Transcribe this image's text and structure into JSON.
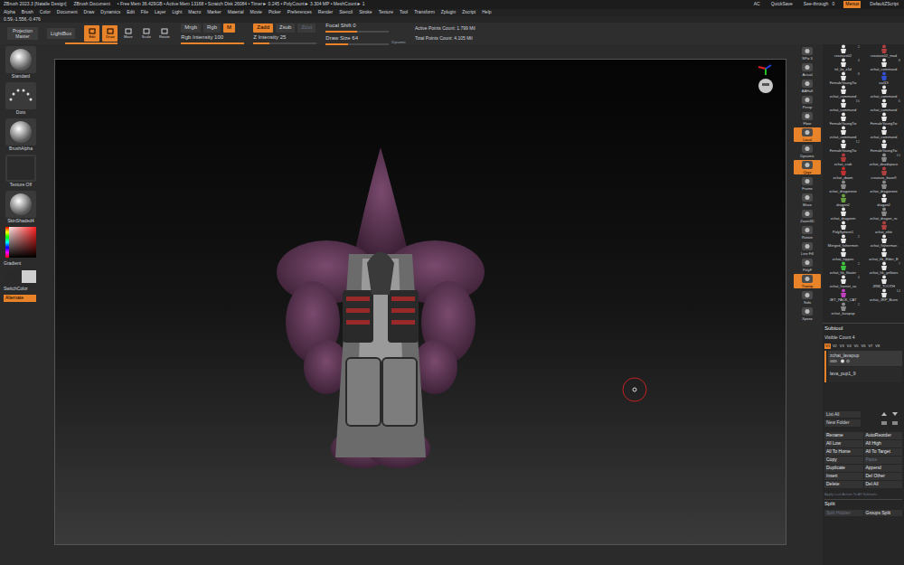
{
  "title_bar": {
    "left": [
      "ZBrush 2023.3 [Natalie Design]",
      "ZBrush Document",
      "• Free Mem 36.429GB • Active Mem 13168 • Scratch Disk 26084 • Timer► 0.245 • PolyCount► 3.304 MP • MeshCount► 1"
    ],
    "right": [
      {
        "label": "AC",
        "selected": false
      },
      {
        "label": "QuickSave",
        "selected": false
      },
      {
        "label": "See-through   0",
        "selected": false
      },
      {
        "label": "Menus",
        "selected": true
      },
      {
        "label": "DefaultZScript",
        "selected": false
      }
    ]
  },
  "menu": [
    "Alpha",
    "Brush",
    "Color",
    "Document",
    "Draw",
    "Dynamics",
    "Edit",
    "File",
    "Layer",
    "Light",
    "Macro",
    "Marker",
    "Material",
    "Movie",
    "Picker",
    "Preferences",
    "Render",
    "Stencil",
    "Stroke",
    "Texture",
    "Tool",
    "Transform",
    "Zplugin",
    "Zscript",
    "Help"
  ],
  "coords": "0.59,-1.556,-0.476",
  "toolbar": {
    "projection": "Projection Master",
    "lightbox": "LightBox",
    "modes": [
      {
        "label": "Edit",
        "selected": true
      },
      {
        "label": "Draw",
        "selected": true
      },
      {
        "label": "Move",
        "selected": false
      },
      {
        "label": "Scale",
        "selected": false
      },
      {
        "label": "Rotate",
        "selected": false
      }
    ],
    "color_modes": [
      {
        "label": "Mrgb",
        "selected": false
      },
      {
        "label": "Rgb",
        "selected": false
      },
      {
        "label": "M",
        "selected": true
      }
    ],
    "rgb_intensity": {
      "label": "Rgb Intensity 100",
      "level": 1
    },
    "z_modes": [
      {
        "label": "Zadd",
        "selected": true,
        "disabled": false
      },
      {
        "label": "Zsub",
        "selected": false,
        "disabled": false
      },
      {
        "label": "Zcut",
        "selected": false,
        "disabled": true
      }
    ],
    "z_intensity": {
      "label": "Z Intensity 25",
      "level": 0.25
    },
    "focal_shift": {
      "label": "Focal Shift 0",
      "level": 0.5
    },
    "draw_size": {
      "label": "Draw Size 64",
      "level": 0.35
    },
    "dynamic": "Dynamic",
    "stats": [
      "Active Points Count: 1.799 Mil",
      "Total Points Count: 4.105 Mil"
    ]
  },
  "left_shelf": {
    "items": [
      "Standard",
      "Dots",
      "BrushAlpha",
      "Texture Off",
      "SkinShaded4"
    ],
    "gradient": "Gradient",
    "switch_color": "SwitchColor",
    "alternate": "Alternate"
  },
  "right_shelf": [
    {
      "label": "SPix 3",
      "selected": false
    },
    {
      "label": "Actual",
      "selected": false
    },
    {
      "label": "AAHalf",
      "selected": false
    },
    {
      "label": "Persp",
      "selected": false
    },
    {
      "label": "Floor",
      "selected": false
    },
    {
      "label": "Local",
      "selected": true
    },
    {
      "label": "Dynamic",
      "selected": false
    },
    {
      "label": "Qxyz",
      "selected": true
    },
    {
      "label": "Frame",
      "selected": false
    },
    {
      "label": "Move",
      "selected": false
    },
    {
      "label": "Zoom3D",
      "selected": false
    },
    {
      "label": "Rotate",
      "selected": false
    },
    {
      "label": "Line Fill",
      "selected": false
    },
    {
      "label": "PolyF",
      "selected": false
    },
    {
      "label": "Transp",
      "selected": true
    },
    {
      "label": "Solo",
      "selected": false
    },
    {
      "label": "Xpose",
      "selected": false
    }
  ],
  "tools": [
    {
      "name": "creature02",
      "count": "2",
      "color": "#e8e8e8"
    },
    {
      "name": "creature02_mod",
      "count": "",
      "color": "#b04040"
    },
    {
      "name": "tsl_liz_z1d",
      "count": "4",
      "color": "#e8e8e8"
    },
    {
      "name": "zchat_command",
      "count": "8",
      "color": "#e8e8e8"
    },
    {
      "name": "FemaleYoungTw",
      "count": "8",
      "color": "#e8e8e8"
    },
    {
      "name": "vail19",
      "count": "",
      "color": "#3050d0"
    },
    {
      "name": "zchat_command",
      "count": "",
      "color": "#e8e8e8"
    },
    {
      "name": "zchat_command",
      "count": "",
      "color": "#e8e8e8"
    },
    {
      "name": "zchat_command",
      "count": "16",
      "color": "#e8e8e8"
    },
    {
      "name": "zchat_command",
      "count": "6",
      "color": "#e8e8e8"
    },
    {
      "name": "FemaleYoungTw",
      "count": "",
      "color": "#e8e8e8"
    },
    {
      "name": "FemaleYoungTw",
      "count": "",
      "color": "#e8e8e8"
    },
    {
      "name": "zchat_command",
      "count": "",
      "color": "#e8e8e8"
    },
    {
      "name": "zchat_command",
      "count": "",
      "color": "#e8e8e8"
    },
    {
      "name": "FemaleYoungTw",
      "count": "12",
      "color": "#e8e8e8"
    },
    {
      "name": "FemaleYoungTw",
      "count": "",
      "color": "#e8e8e8"
    },
    {
      "name": "zchat_crab",
      "count": "",
      "color": "#b03a3a"
    },
    {
      "name": "zchat_deadspace",
      "count": "10",
      "color": "#8a8a8a"
    },
    {
      "name": "zchat_doom",
      "count": "",
      "color": "#c03030"
    },
    {
      "name": "creature_base9",
      "count": "",
      "color": "#b04040"
    },
    {
      "name": "zchat_dragonese",
      "count": "",
      "color": "#8a8a8a"
    },
    {
      "name": "zchat_dragonese",
      "count": "",
      "color": "#8a8a8a"
    },
    {
      "name": "dragon2",
      "count": "",
      "color": "#6aa040"
    },
    {
      "name": "dragon2",
      "count": "",
      "color": "#e8e8e8"
    },
    {
      "name": "zchat_dragonm",
      "count": "",
      "color": "#e8e8e8"
    },
    {
      "name": "zchat_dragon_sc",
      "count": "",
      "color": "#8a8a8a"
    },
    {
      "name": "PolySphere1",
      "count": "",
      "color": "#e8e8e8"
    },
    {
      "name": "zchat_elite",
      "count": "",
      "color": "#b04040"
    },
    {
      "name": "Merged_fishermen",
      "count": "2",
      "color": "#e8e8e8"
    },
    {
      "name": "zchat_fisherman",
      "count": "",
      "color": "#e8e8e8"
    },
    {
      "name": "zchat_hippos",
      "count": "",
      "color": "#e8e8e8"
    },
    {
      "name": "zchat_hk_Elder_E",
      "count": "",
      "color": "#e8e8e8"
    },
    {
      "name": "zchat_hk_floater",
      "count": "2",
      "color": "#40c040"
    },
    {
      "name": "zchat_hk_yellows",
      "count": "7",
      "color": "#e8e8e8"
    },
    {
      "name": "zchat_hornet_sa",
      "count": "4",
      "color": "#e8e8e8"
    },
    {
      "name": "JRW_TOOTH",
      "count": "",
      "color": "#e8e8e8"
    },
    {
      "name": "JET_PACK_CAT",
      "count": "",
      "color": "#c040c0"
    },
    {
      "name": "zchat_JRP_Bunn",
      "count": "14",
      "color": "#e8e8e8"
    },
    {
      "name": "zchat_lavapup",
      "count": "2",
      "color": "#8a8a8a"
    }
  ],
  "subtool": {
    "title": "Subtool",
    "visible_count": "Visible Count 4",
    "views": [
      {
        "label": "V1",
        "selected": true
      },
      {
        "label": "V2",
        "selected": false
      },
      {
        "label": "V3",
        "selected": false
      },
      {
        "label": "V4",
        "selected": false
      },
      {
        "label": "V5",
        "selected": false
      },
      {
        "label": "V6",
        "selected": false
      },
      {
        "label": "V7",
        "selected": false
      },
      {
        "label": "V8",
        "selected": false
      }
    ],
    "items": [
      {
        "name": "zchat_lavapup",
        "selected": true
      },
      {
        "name": "lava_pup1_9",
        "selected": false
      }
    ],
    "list_all": "List All",
    "new_folder": "New Folder",
    "buttons": [
      {
        "label": "Rename",
        "disabled": false
      },
      {
        "label": "AutoReorder",
        "disabled": false
      },
      {
        "label": "All Low",
        "disabled": false
      },
      {
        "label": "All High",
        "disabled": false
      },
      {
        "label": "All To Home",
        "disabled": false
      },
      {
        "label": "All To Target",
        "disabled": false
      },
      {
        "label": "Copy",
        "disabled": false
      },
      {
        "label": "Paste",
        "disabled": true
      },
      {
        "label": "Duplicate",
        "disabled": false
      },
      {
        "label": "Append",
        "disabled": false
      },
      {
        "label": "Insert",
        "disabled": false
      },
      {
        "label": "Del Other",
        "disabled": false
      },
      {
        "label": "Delete",
        "disabled": false
      },
      {
        "label": "Del All",
        "disabled": false
      }
    ],
    "apply_all": "Apply Last Action To All Subtools",
    "split": "Split",
    "split_buttons": [
      {
        "label": "Split Hidden",
        "disabled": true
      },
      {
        "label": "Groups Split",
        "disabled": false
      }
    ]
  }
}
